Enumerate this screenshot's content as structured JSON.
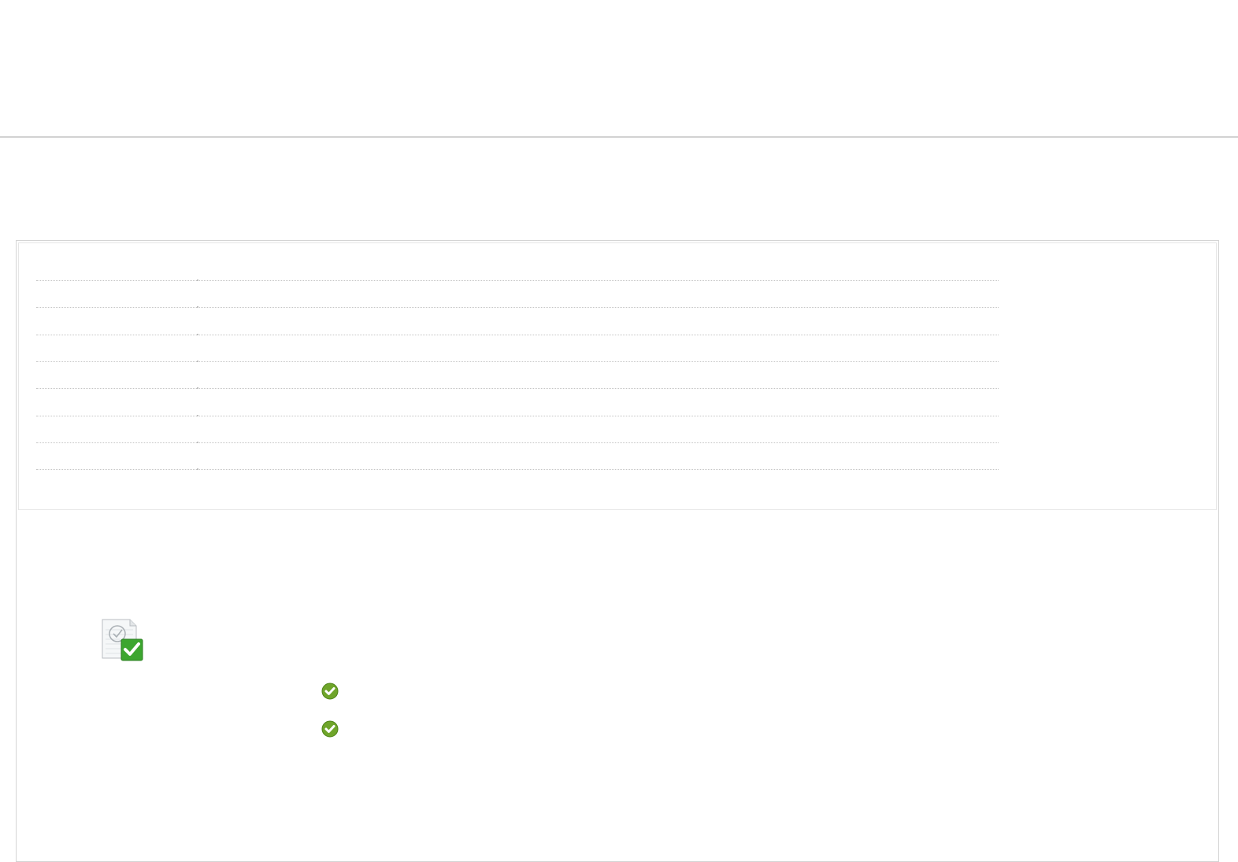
{
  "header": {
    "title": ""
  },
  "summary": {
    "rows": [
      {
        "label": "",
        "value": ""
      },
      {
        "label": "",
        "value": ""
      },
      {
        "label": "",
        "value": ""
      },
      {
        "label": "",
        "value": ""
      },
      {
        "label": "",
        "value": ""
      },
      {
        "label": "",
        "value": ""
      },
      {
        "label": "",
        "value": ""
      },
      {
        "label": "",
        "value": ""
      }
    ]
  },
  "results": {
    "icon": "document-check-icon",
    "check_items": [
      {
        "icon": "green-check-icon",
        "text": ""
      },
      {
        "icon": "green-check-icon",
        "text": ""
      }
    ]
  },
  "colors": {
    "check_green": "#6fa52a",
    "badge_green": "#3ca62f",
    "divider": "#d2d2d2",
    "panel_border": "#d4d4d4",
    "dotted_rule": "#c4c4c4"
  }
}
